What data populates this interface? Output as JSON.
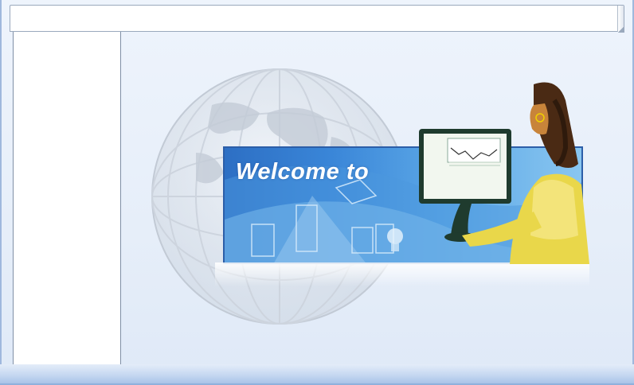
{
  "banner": {
    "title": "Welcome to"
  },
  "colors": {
    "page_background": "#e7eff9",
    "banner_blue": "#3a86d8",
    "panel_white": "#ffffff",
    "border_blue": "#9fb8dd"
  },
  "icons": {
    "globe": "globe-icon",
    "monitor": "monitor-icon",
    "woman": "woman-illustration",
    "lightbulb": "lightbulb-icon"
  }
}
